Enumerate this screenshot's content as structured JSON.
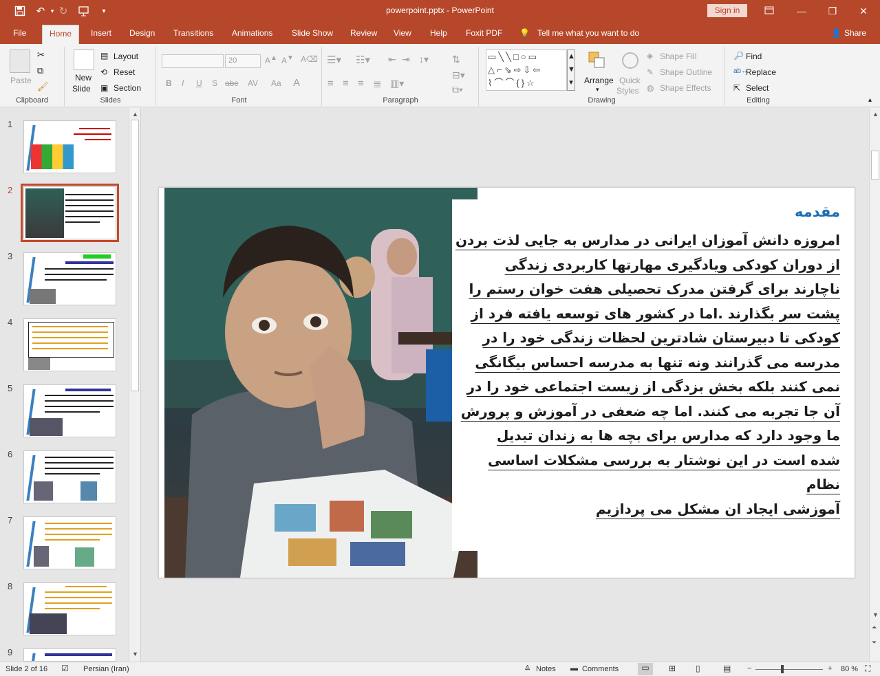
{
  "app": {
    "title": "powerpoint.pptx  -  PowerPoint",
    "sign_in": "Sign in"
  },
  "menu": {
    "tabs": [
      "File",
      "Home",
      "Insert",
      "Design",
      "Transitions",
      "Animations",
      "Slide Show",
      "Review",
      "View",
      "Help",
      "Foxit PDF"
    ],
    "tell_me": "Tell me what you want to do",
    "share": "Share"
  },
  "ribbon": {
    "clipboard": {
      "paste": "Paste",
      "label": "Clipboard"
    },
    "slides": {
      "new_slide_1": "New",
      "new_slide_2": "Slide",
      "layout": "Layout",
      "reset": "Reset",
      "section": "Section",
      "label": "Slides"
    },
    "font": {
      "size": "20",
      "bold": "B",
      "italic": "I",
      "underline": "U",
      "shadow": "S",
      "strike": "abc",
      "spacing": "AV",
      "case": "Aa",
      "color": "A",
      "label": "Font"
    },
    "paragraph": {
      "label": "Paragraph"
    },
    "drawing": {
      "arrange": "Arrange",
      "quick_styles_1": "Quick",
      "quick_styles_2": "Styles",
      "shape_fill": "Shape Fill",
      "shape_outline": "Shape Outline",
      "shape_effects": "Shape Effects",
      "label": "Drawing"
    },
    "editing": {
      "find": "Find",
      "replace": "Replace",
      "select": "Select",
      "label": "Editing"
    }
  },
  "thumbnails": [
    "1",
    "2",
    "3",
    "4",
    "5",
    "6",
    "7",
    "8",
    "9"
  ],
  "slide": {
    "heading": "مقدمه",
    "lines": [
      "امروزه دانش آموزان ایرانی در مدارس به جایی لذت بردن",
      "از دوران کودکی ویادگیری مهارتها کاربردی زندگی",
      "ناچارند برای گرفتن مدرک تحصیلی هفت خوان رستم را",
      "پشت سر بگذارند .اما در کشور های توسعه یافته فرد از",
      "کودکی تا دبیرستان شادترین لحظات زندگی خود را در",
      "مدرسه می گذرانند ونه تنها به مدرسه احساس بیگانگی",
      "نمی کنند بلکه بخش بزدگی از زیست اجتماعی خود را در",
      "آن جا تجربه می کنند. اما چه ضعفی در آموزش و پرورش",
      "ما وجود دارد که مدارس برای بچه ها به زندان تبدیل",
      "شده است در این نوشتار به بررسی مشکلات اساسی نظام",
      "آموزشی ایجاد ان مشکل می پردازیم"
    ]
  },
  "status": {
    "slide_of": "Slide 2 of 16",
    "language": "Persian (Iran)",
    "notes": "Notes",
    "comments": "Comments",
    "zoom": "80 %"
  }
}
